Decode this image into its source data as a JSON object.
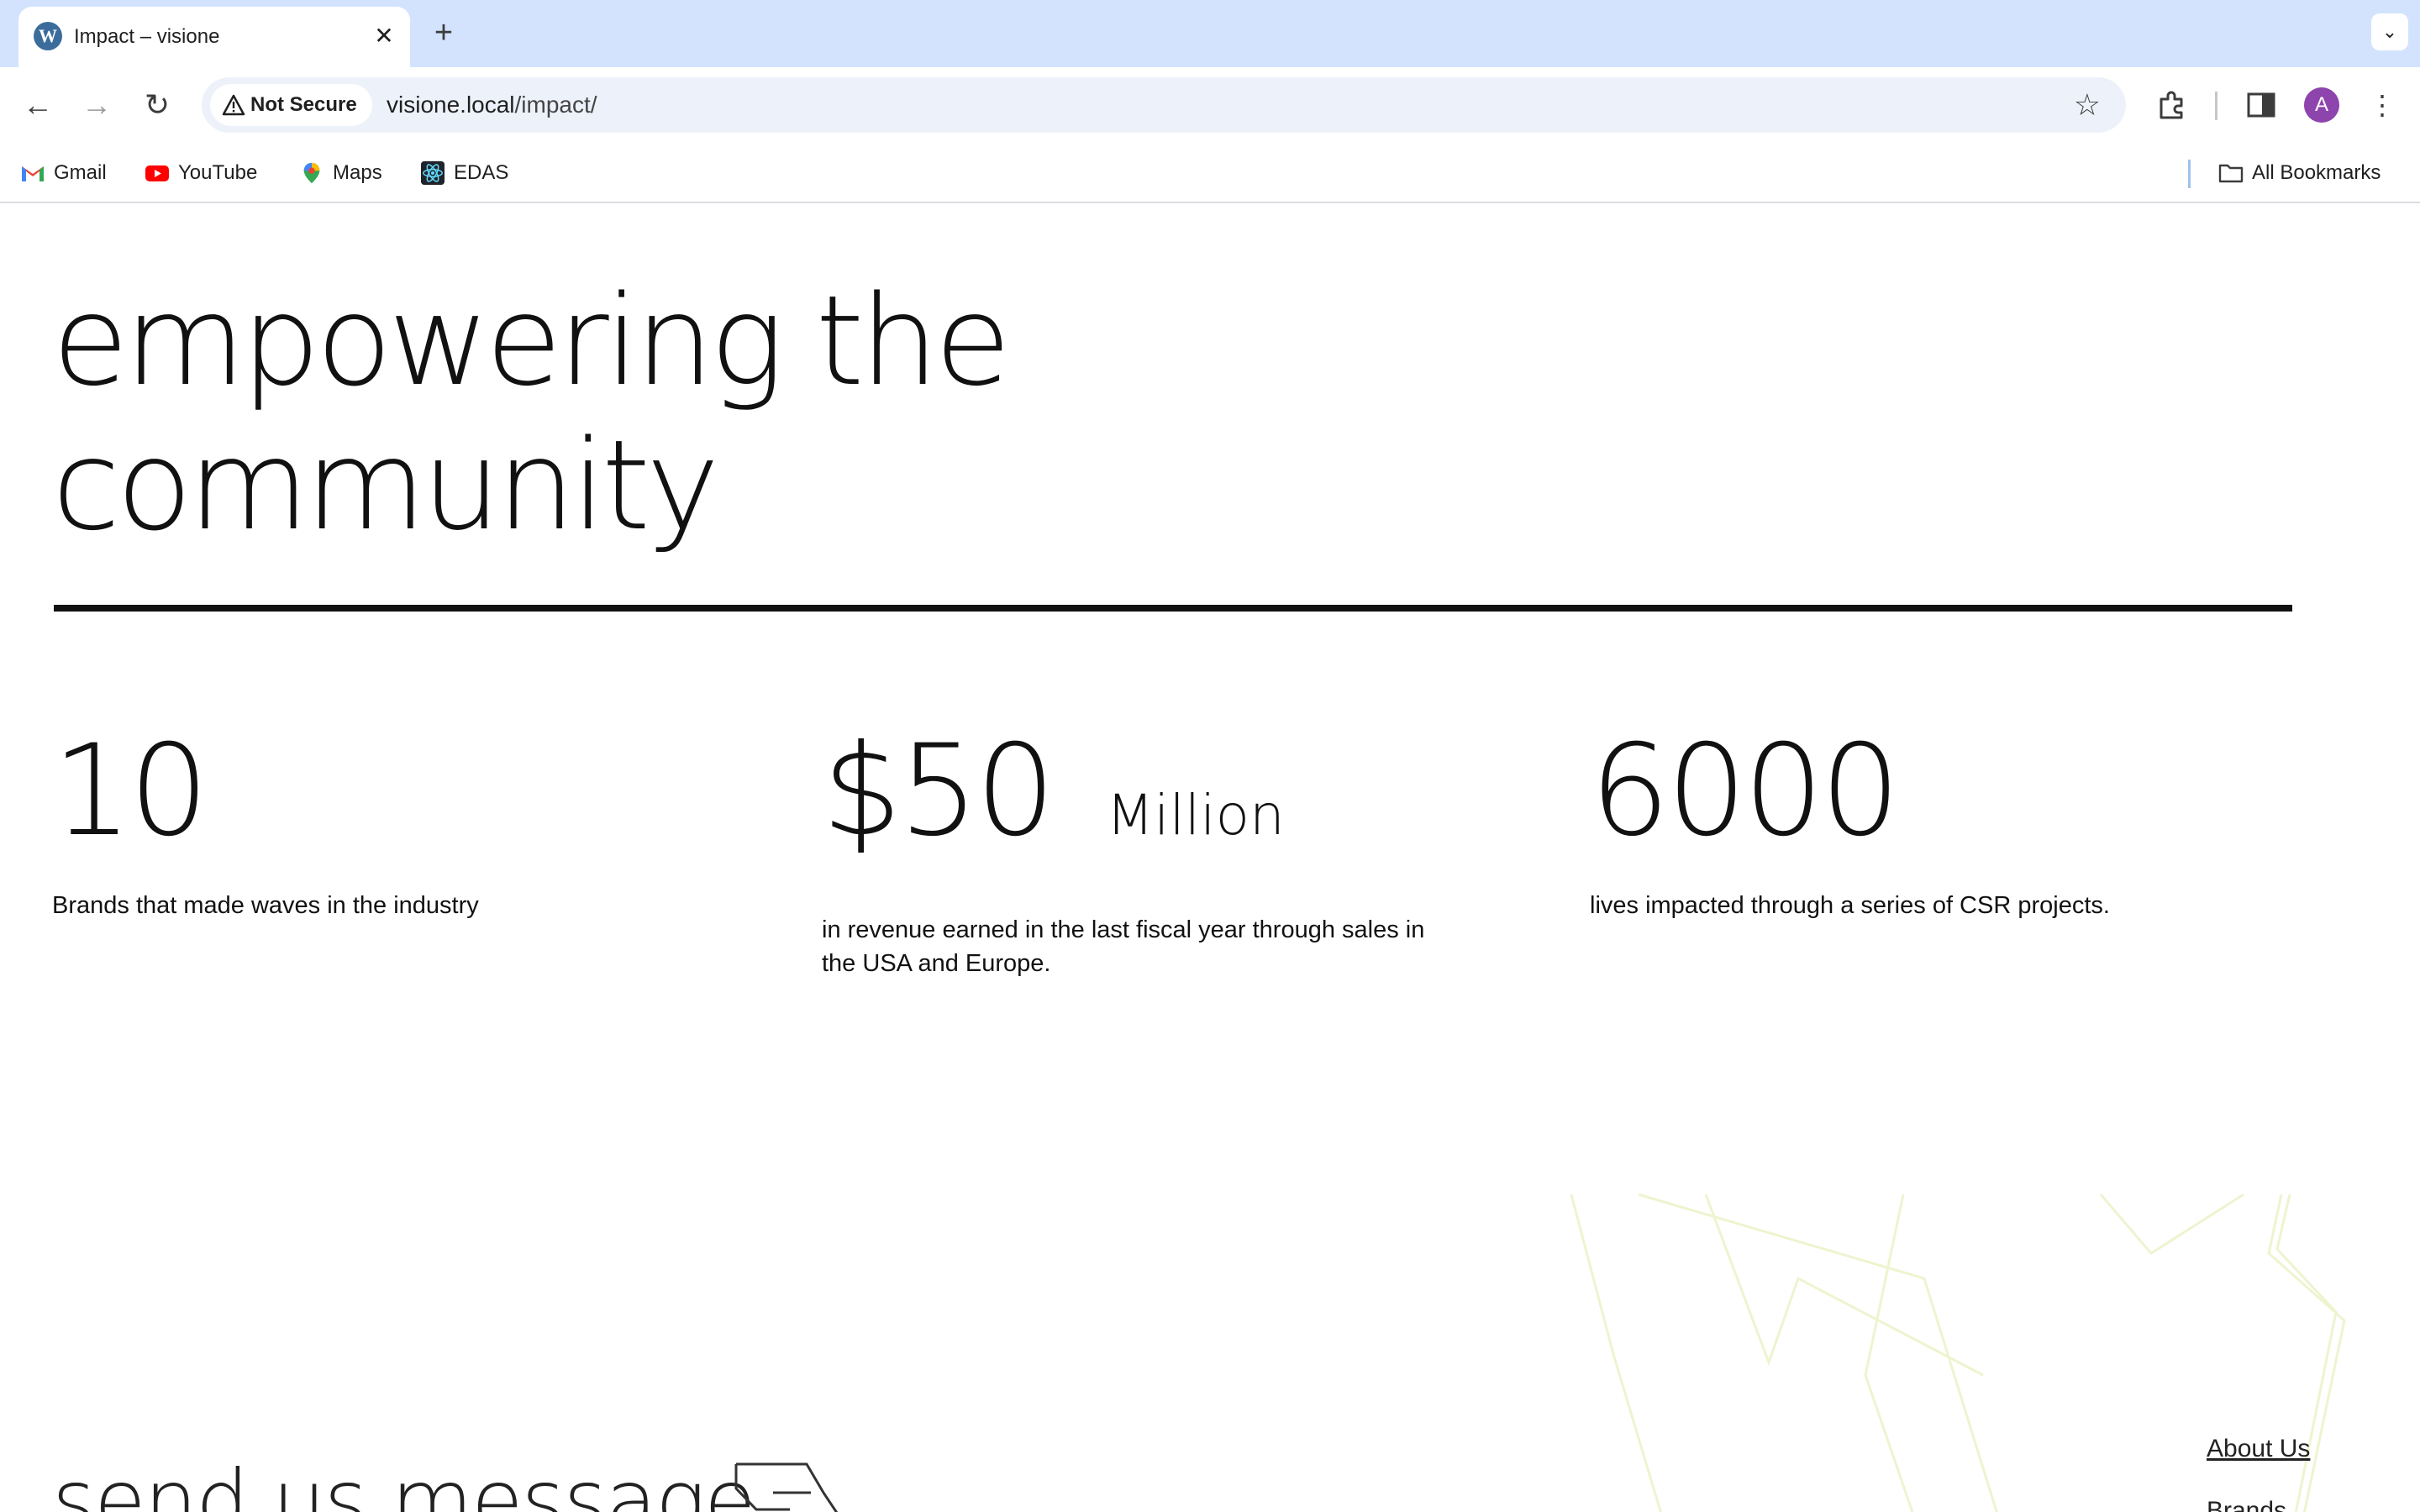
{
  "browser": {
    "tab": {
      "title": "Impact – visione",
      "favicon": "wordpress-icon"
    },
    "omnibox": {
      "security_label": "Not Secure",
      "url_host": "visione.local",
      "url_path": "/impact/"
    },
    "bookmarks": [
      {
        "label": "Gmail",
        "icon": "gmail-icon"
      },
      {
        "label": "YouTube",
        "icon": "youtube-icon"
      },
      {
        "label": "Maps",
        "icon": "maps-icon"
      },
      {
        "label": "EDAS",
        "icon": "react-icon"
      }
    ],
    "all_bookmarks_label": "All Bookmarks",
    "profile_initial": "A"
  },
  "page": {
    "heading_line1": "empowering the",
    "heading_line2": "community",
    "stats": [
      {
        "value": "10",
        "unit": "",
        "description": "Brands that made waves in the industry"
      },
      {
        "value": "$50",
        "unit": "Million",
        "description": "in revenue earned in the last fiscal year through sales in the USA and Europe."
      },
      {
        "value": "6000",
        "unit": "",
        "description": "lives impacted through a series of CSR projects."
      }
    ],
    "message_heading": "send us message",
    "footer_links": [
      "About Us",
      "Brands"
    ]
  },
  "colors": {
    "tabstrip_bg": "#d3e3fd",
    "omnibox_bg": "#edf2fa",
    "text": "#111111",
    "deco_lines": "#e8f0c8"
  }
}
